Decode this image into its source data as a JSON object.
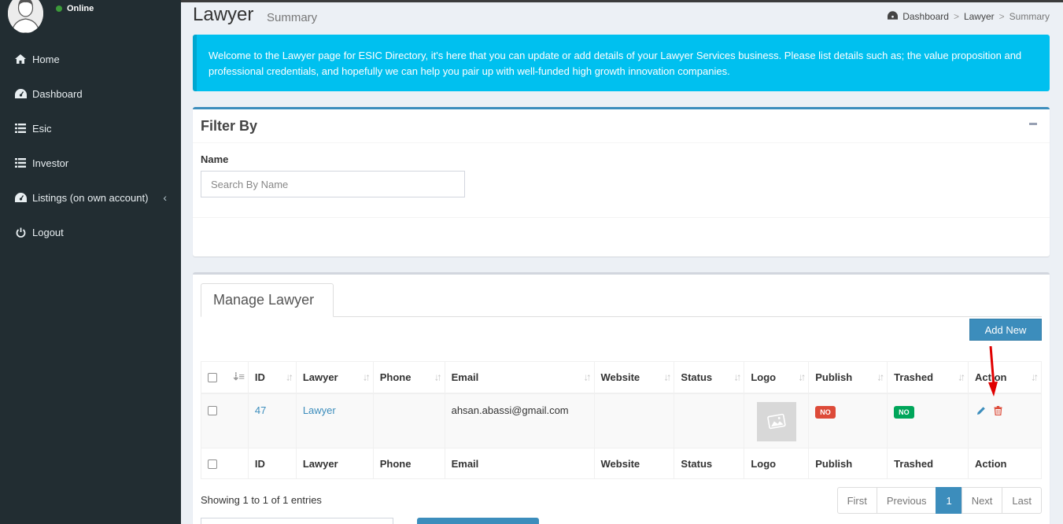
{
  "sidebar": {
    "status": "Online",
    "menu": [
      {
        "label": "Home",
        "icon": "home-icon"
      },
      {
        "label": "Dashboard",
        "icon": "dashboard-icon"
      },
      {
        "label": "Esic",
        "icon": "list-icon"
      },
      {
        "label": "Investor",
        "icon": "list-icon"
      },
      {
        "label": "Listings (on own account)",
        "icon": "dashboard-icon"
      },
      {
        "label": "Logout",
        "icon": "power-icon"
      }
    ]
  },
  "header": {
    "title": "Lawyer",
    "subtitle": "Summary",
    "breadcrumb": [
      "Dashboard",
      "Lawyer",
      "Summary"
    ],
    "breadcrumb_sep": ">"
  },
  "callout": {
    "text": "Welcome to the Lawyer page for ESIC Directory, it's here that you can update or add details of your Lawyer Services business. Please list details such as; the value proposition and professional credentials, and hopefully we can help you pair up with well-funded high growth innovation companies."
  },
  "filter": {
    "title": "Filter By",
    "name_label": "Name",
    "name_placeholder": "Search By Name",
    "name_value": ""
  },
  "manage": {
    "tab_label": "Manage Lawyer",
    "add_new_label": "Add New",
    "columns": [
      "ID",
      "Lawyer",
      "Phone",
      "Email",
      "Website",
      "Status",
      "Logo",
      "Publish",
      "Trashed",
      "Action"
    ],
    "rows": [
      {
        "id": "47",
        "lawyer": "Lawyer",
        "phone": "",
        "email": "ahsan.abassi@gmail.com",
        "website": "",
        "status": "",
        "publish": "NO",
        "trashed": "NO"
      }
    ],
    "showing_text": "Showing 1 to 1 of 1 entries",
    "pagination": [
      "First",
      "Previous",
      "1",
      "Next",
      "Last"
    ]
  },
  "colors": {
    "sidebar_bg": "#222d32",
    "callout_bg": "#00c0ef",
    "primary": "#3c8dbc",
    "danger": "#dd4b39",
    "success": "#00a65a",
    "arrow": "#e00000"
  }
}
